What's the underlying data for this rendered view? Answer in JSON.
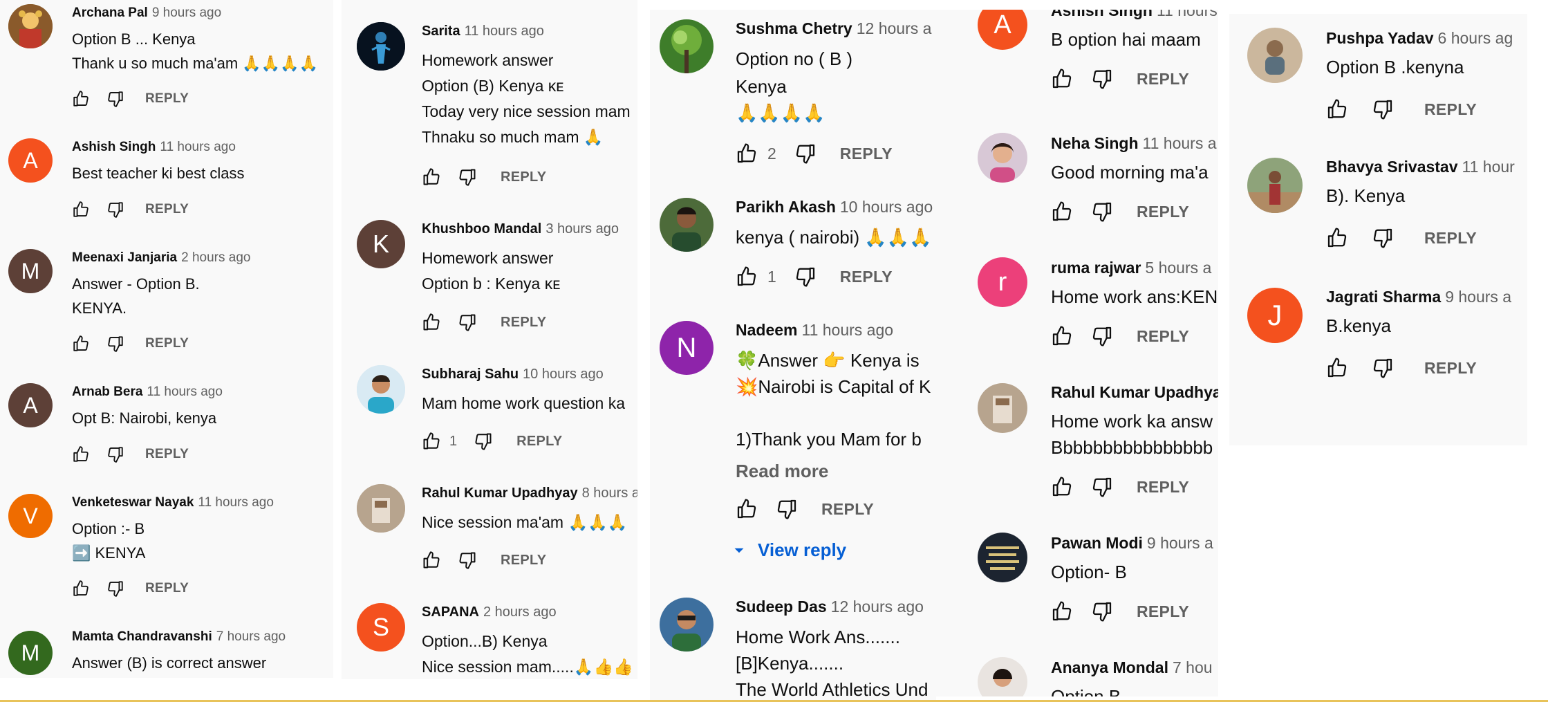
{
  "reply_label": "REPLY",
  "columns": [
    {
      "comments": [
        {
          "author": "Archana Pal",
          "time": "9 hours ago",
          "lines": [
            "Option B ... Kenya",
            "Thank u so much ma'am 🙏🙏🙏🙏"
          ],
          "likes": ""
        },
        {
          "author": "Ashish Singh",
          "time": "11 hours ago",
          "lines": [
            "Best teacher ki best class"
          ],
          "likes": ""
        },
        {
          "author": "Meenaxi Janjaria",
          "time": "2 hours ago",
          "lines": [
            "Answer - Option B.",
            "KENYA."
          ],
          "likes": ""
        },
        {
          "author": "Arnab Bera",
          "time": "11 hours ago",
          "lines": [
            "Opt B: Nairobi, kenya"
          ],
          "likes": ""
        },
        {
          "author": "Venketeswar Nayak",
          "time": "11 hours ago",
          "lines": [
            "Option :- B",
            "➡️ KENYA"
          ],
          "likes": ""
        },
        {
          "author": "Mamta Chandravanshi",
          "time": "7 hours ago",
          "lines": [
            "Answer (B) is correct answer"
          ],
          "likes": ""
        }
      ]
    },
    {
      "comments": [
        {
          "author": "Sarita",
          "time": "11 hours ago",
          "lines": [
            "Homework answer",
            "Option (B) Kenya ᴋᴇ",
            "Today very nice session mam",
            "Thnaku so much mam 🙏"
          ],
          "likes": ""
        },
        {
          "author": "Khushboo Mandal",
          "time": "3 hours ago",
          "lines": [
            "Homework answer",
            "Option b : Kenya ᴋᴇ"
          ],
          "likes": ""
        },
        {
          "author": "Subharaj Sahu",
          "time": "10 hours ago",
          "lines": [
            "Mam home work question ka"
          ],
          "likes": "1"
        },
        {
          "author": "Rahul Kumar Upadhyay",
          "time": "8 hours a",
          "lines": [
            "Nice session ma'am 🙏🙏🙏"
          ],
          "likes": ""
        },
        {
          "author": "SAPANA",
          "time": "2 hours ago",
          "lines": [
            "Option...B) Kenya",
            "Nice session mam.....🙏👍👍"
          ],
          "likes": ""
        }
      ]
    },
    {
      "comments": [
        {
          "author": "Sushma Chetry",
          "time": "12 hours a",
          "lines": [
            "Option no ( B )",
            "Kenya",
            "🙏🙏🙏🙏"
          ],
          "likes": "2"
        },
        {
          "author": "Parikh Akash",
          "time": "10 hours ago",
          "lines": [
            "kenya   ( nairobi) 🙏🙏🙏"
          ],
          "likes": "1"
        },
        {
          "author": "Nadeem",
          "time": "11 hours ago",
          "lines": [
            "🍀Answer 👉 Kenya is",
            "💥Nairobi is Capital of K",
            "",
            "1)Thank you Mam  for b"
          ],
          "likes": "",
          "read_more": "Read more",
          "view_reply": "View reply"
        },
        {
          "author": "Sudeep Das",
          "time": "12 hours ago",
          "lines": [
            "Home Work Ans.......",
            "[B]Kenya.......",
            "The World Athletics Und"
          ],
          "likes": ""
        }
      ]
    },
    {
      "comments": [
        {
          "author": "Ashish Singh",
          "time": "11 hours",
          "lines": [
            "B option hai maam"
          ],
          "likes": ""
        },
        {
          "author": "Neha Singh",
          "time": "11 hours a",
          "lines": [
            "Good morning ma'a"
          ],
          "likes": ""
        },
        {
          "author": "ruma rajwar",
          "time": "5 hours a",
          "lines": [
            "Home work ans:KEN"
          ],
          "likes": ""
        },
        {
          "author": "Rahul Kumar Upadhya",
          "time": "",
          "lines": [
            "Home work ka answ",
            "Bbbbbbbbbbbbbbbb"
          ],
          "likes": ""
        },
        {
          "author": "Pawan Modi",
          "time": "9 hours a",
          "lines": [
            "Option- B"
          ],
          "likes": ""
        },
        {
          "author": "Ananya Mondal",
          "time": "7 hou",
          "lines": [
            "Option B"
          ],
          "likes": ""
        }
      ]
    },
    {
      "comments": [
        {
          "author": "Pushpa Yadav",
          "time": "6 hours ag",
          "lines": [
            "Option B .kenyna"
          ],
          "likes": ""
        },
        {
          "author": "Bhavya Srivastav",
          "time": "11 hour",
          "lines": [
            "B). Kenya"
          ],
          "likes": ""
        },
        {
          "author": "Jagrati Sharma",
          "time": "9 hours a",
          "lines": [
            "B.kenya"
          ],
          "likes": ""
        }
      ]
    }
  ],
  "avatars": [
    [
      "photo",
      "A",
      "A",
      "A",
      "V",
      "M"
    ],
    [
      "photo",
      "K",
      "photo",
      "photo",
      "S"
    ],
    [
      "photo",
      "photo",
      "N",
      "photo"
    ],
    [
      "A",
      "photo",
      "r",
      "photo",
      "photo",
      "photo"
    ],
    [
      "photo",
      "photo",
      "J"
    ]
  ],
  "colors": {
    "letter_avatars": {
      "Ashish Singh": "#f4511e",
      "Meenaxi Janjaria": "#5d4037",
      "Arnab Bera": "#5d4037",
      "Venketeswar Nayak": "#ef6c00",
      "Mamta Chandravanshi": "#33691e",
      "Khushboo Mandal": "#5d4037",
      "SAPANA": "#f4511e",
      "Nadeem": "#8e24aa",
      "Ashish Singh (col4)": "#f4511e",
      "ruma rajwar": "#ec407a",
      "Jagrati Sharma": "#f4511e"
    },
    "link": "#065fd4",
    "secondary_text": "#606060",
    "bottom_rule": "#e8c35a"
  }
}
